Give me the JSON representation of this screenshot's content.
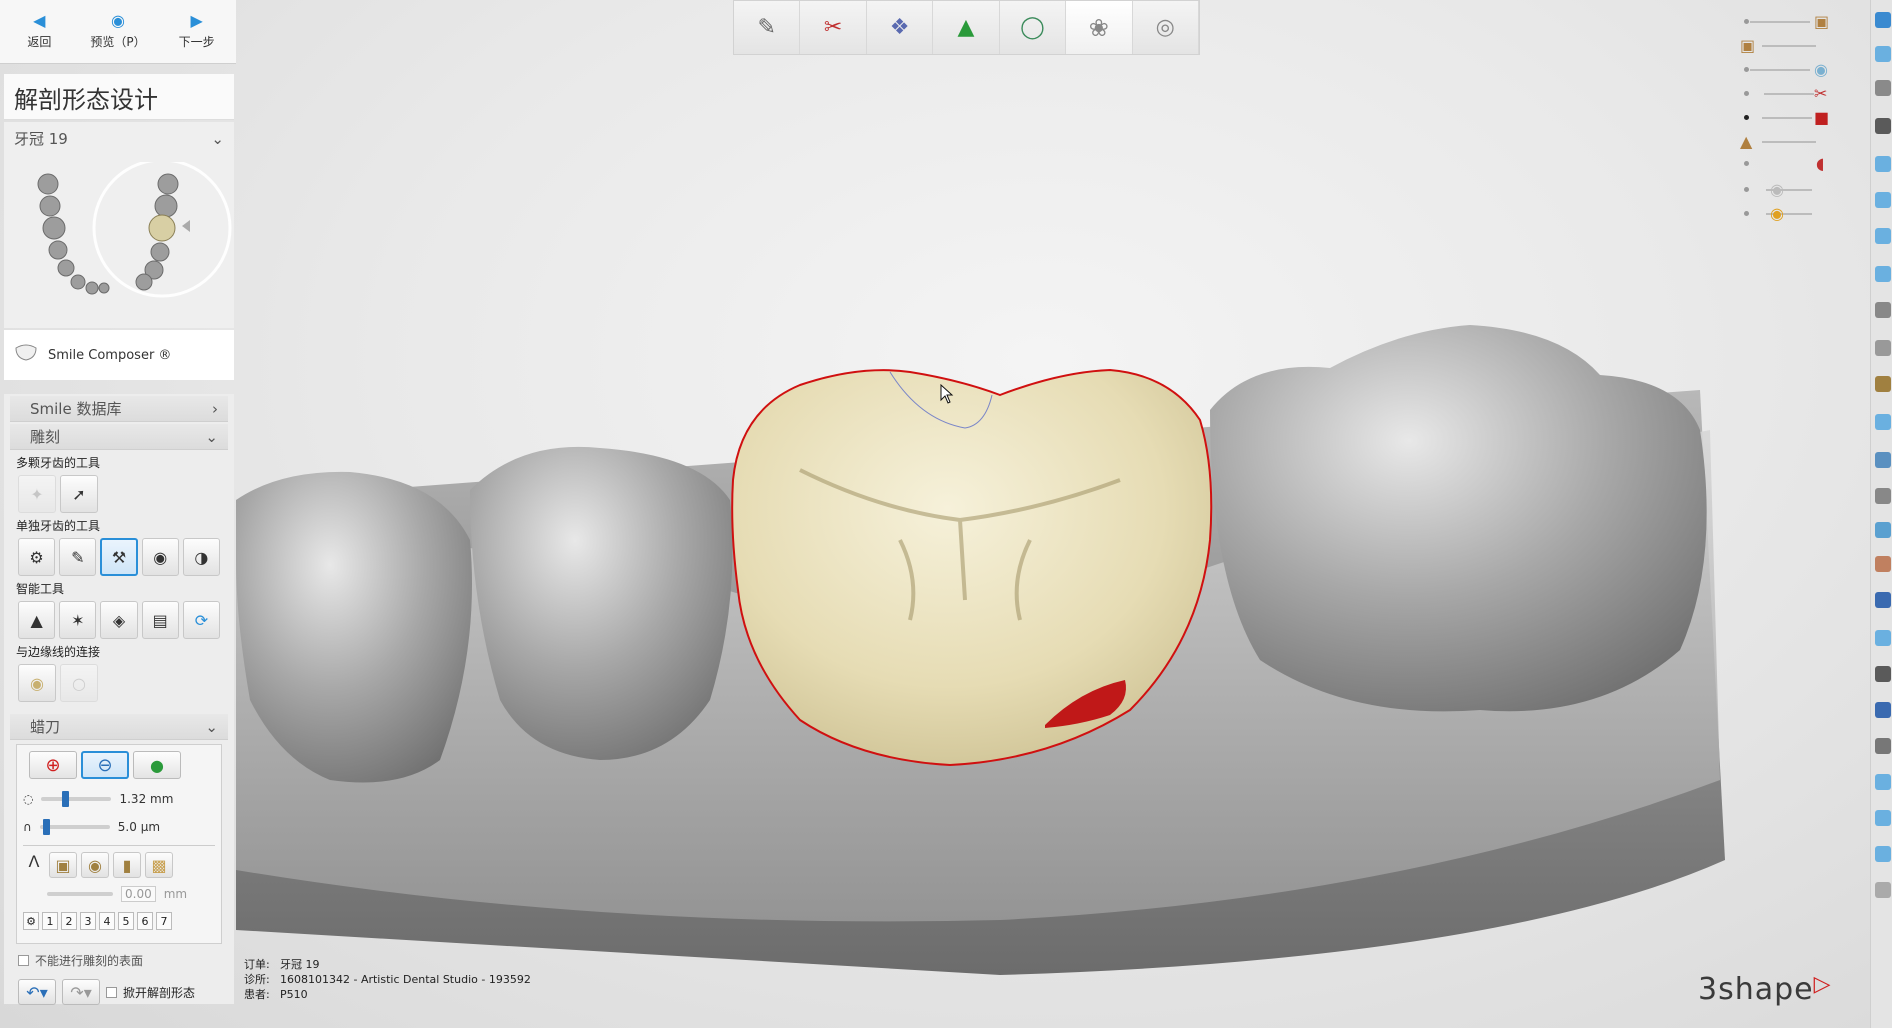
{
  "nav": {
    "back_label": "返回",
    "preview_label": "预览（P）",
    "next_label": "下一步"
  },
  "panel": {
    "title": "解剖形态设计",
    "tooth_selector": "牙冠 19",
    "smile_composer": "Smile Composer ®"
  },
  "sections": {
    "smile_db": "Smile 数据库",
    "sculpt": "雕刻",
    "multi_tooth_tools": "多颗牙齿的工具",
    "single_tooth_tools": "单独牙齿的工具",
    "smart_tools": "智能工具",
    "margin_connect": "与边缘线的连接",
    "wax_knife": "蜡刀"
  },
  "wax_knife": {
    "radius_value": "1.32 mm",
    "strength_value": "5.0 µm",
    "offset_value": "0.00",
    "offset_unit": "mm",
    "radius_level": 0.33,
    "strength_level": 0.05,
    "number_buttons": [
      "1",
      "2",
      "3",
      "4",
      "5",
      "6",
      "7"
    ]
  },
  "options": {
    "no_sculpt_label": "不能进行雕刻的表面",
    "move_anatomy_label": "掀开解剖形态"
  },
  "order_info": {
    "order_key": "订单:",
    "order_value": "牙冠 19",
    "clinic_key": "诊所:",
    "clinic_value": "1608101342 - Artistic Dental Studio - 193592",
    "patient_key": "患者:",
    "patient_value": "P510"
  },
  "brand": {
    "logo_text": "3shape"
  },
  "colors": {
    "accent": "#2a8fd8",
    "margin_line": "#d01010",
    "crown": "#e9e2c0",
    "gingiva_model": "#9a9a9a"
  },
  "icons": {
    "back": "arrow-left-icon",
    "preview": "eye-icon",
    "next": "arrow-right-icon",
    "logo_mark": "triangle-logo-icon"
  }
}
